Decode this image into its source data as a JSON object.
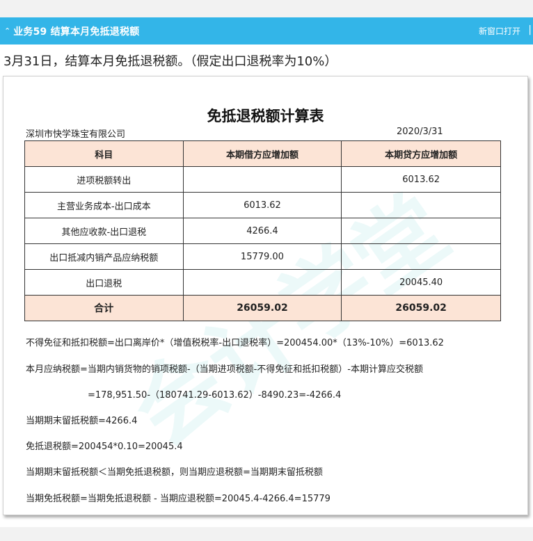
{
  "header": {
    "title": "业务59 结算本月免抵退税额",
    "open_label": "新窗口打开",
    "edge_glyph": "|"
  },
  "description": "3月31日，结算本月免抵退税额。（假定出口退税率为10%）",
  "document": {
    "watermark": "会计学堂",
    "title": "免抵退税额计算表",
    "company": "深圳市快学珠宝有限公司",
    "date": "2020/3/31",
    "table": {
      "headers": [
        "科目",
        "本期借方应增加额",
        "本期贷方应增加额"
      ],
      "rows": [
        [
          "进项税额转出",
          "",
          "6013.62"
        ],
        [
          "主营业务成本-出口成本",
          "6013.62",
          ""
        ],
        [
          "其他应收款-出口退税",
          "4266.4",
          ""
        ],
        [
          "出口抵减内销产品应纳税额",
          "15779.00",
          ""
        ],
        [
          "出口退税",
          "",
          "20045.40"
        ]
      ],
      "total": [
        "合计",
        "26059.02",
        "26059.02"
      ]
    },
    "notes": [
      "不得免征和抵扣税额=出口离岸价*（增值税税率-出口退税率）=200454.00*（13%-10%）=6013.62",
      "本月应纳税额=当期内销货物的销项税额-（当期进项税额-不得免征和抵扣税额）-本期计算应交税额",
      "=178,951.50-（180741.29-6013.62）-8490.23=-4266.4",
      "当期期末留抵税额=4266.4",
      "免抵退税额=200454*0.10=20045.4",
      "当期期末留抵税额＜当期免抵退税额，则当期应退税额=当期期末留抵税额",
      "当期免抵税额=当期免抵退税额 - 当期应退税额=20045.4-4266.4=15779"
    ]
  },
  "colors": {
    "header_bg": "#33b5e8",
    "table_header_bg": "#fce4d6"
  }
}
